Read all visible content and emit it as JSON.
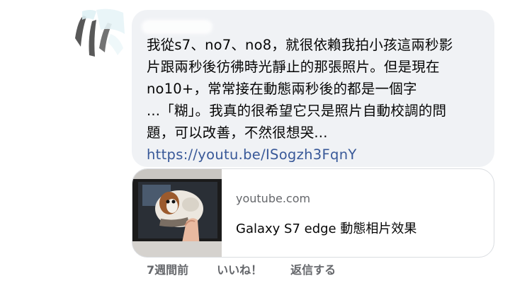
{
  "comment": {
    "text": "我從s7、no7、no8，就很依賴我拍小孩這兩秒影\n片跟兩秒後彷彿時光靜止的那張照片。但是現在\nno10+，常常接在動態兩秒後的都是一個字\n...「糊」。我真的很希望它只是照片自動校調的問\n題，可以改善，不然很想哭...",
    "link_text": "https://youtu.be/ISogzh3FqnY"
  },
  "link_preview": {
    "domain": "youtube.com",
    "title": "Galaxy S7 edge 動態相片效果"
  },
  "actions": {
    "time": "7週間前",
    "like": "いいね！",
    "reply": "返信する"
  },
  "colors": {
    "bubble_bg": "#f0f2f5",
    "link": "#385898",
    "meta_gray": "#65676b"
  }
}
